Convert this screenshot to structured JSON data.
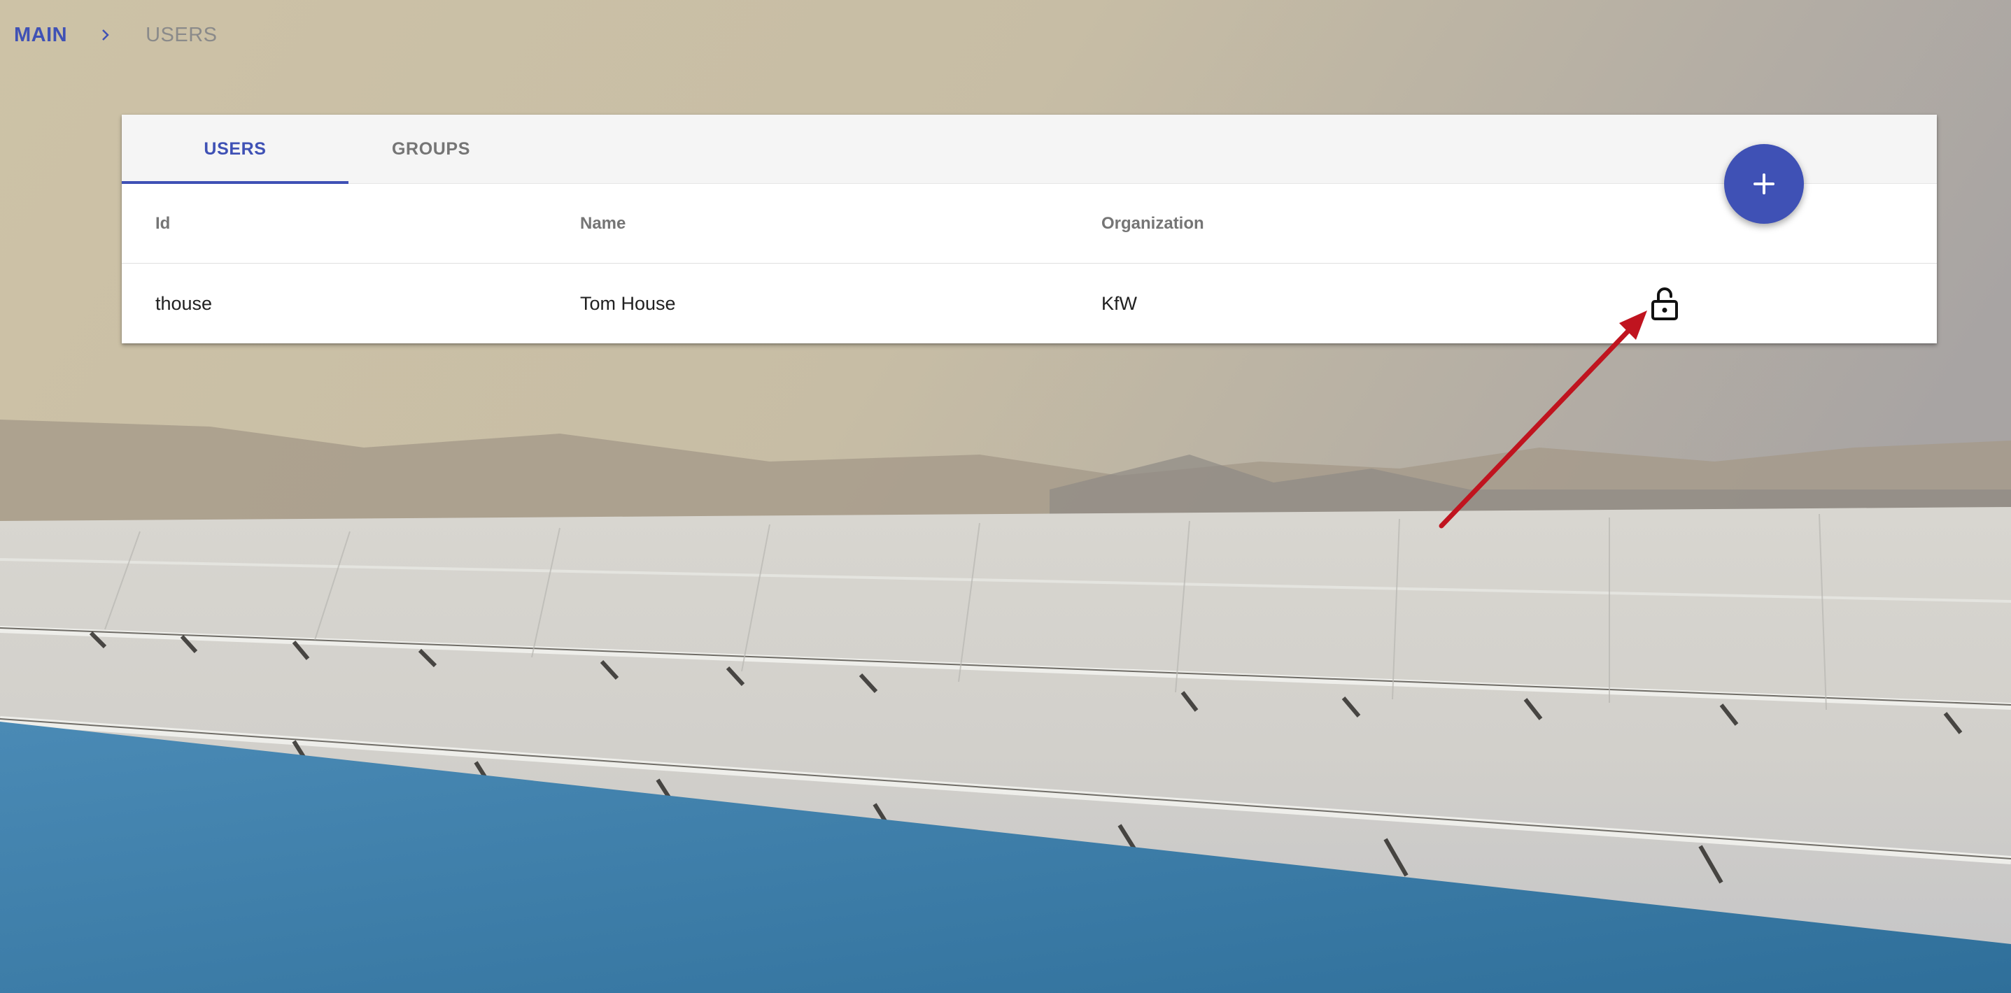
{
  "breadcrumb": {
    "root": "MAIN",
    "current": "USERS"
  },
  "tabs": [
    {
      "label": "USERS",
      "active": true
    },
    {
      "label": "GROUPS",
      "active": false
    }
  ],
  "table": {
    "headers": [
      "Id",
      "Name",
      "Organization"
    ],
    "rows": [
      {
        "id": "thouse",
        "name": "Tom House",
        "organization": "KfW",
        "action_icon": "lock-open-icon"
      }
    ]
  },
  "fab": {
    "icon": "plus-icon"
  },
  "colors": {
    "accent": "#3f51b5",
    "annotation_arrow": "#c0141f",
    "footer_blue": "#3d7ea8"
  }
}
